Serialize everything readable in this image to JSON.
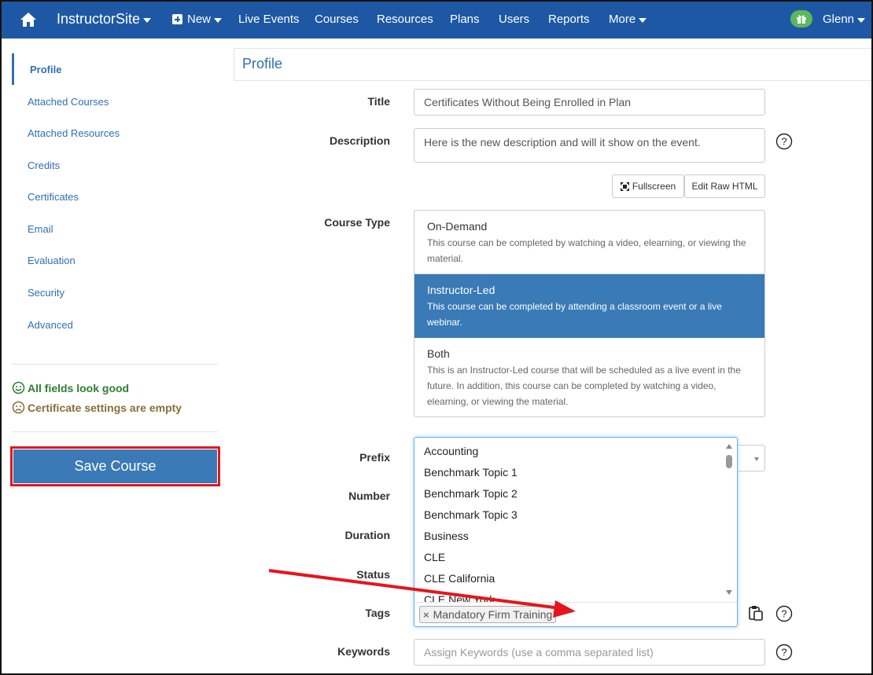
{
  "nav": {
    "brand": "InstructorSite",
    "new_label": "New",
    "items": [
      "Live Events",
      "Courses",
      "Resources",
      "Plans",
      "Users",
      "Reports",
      "More"
    ],
    "user": "Glenn",
    "home_icon": "home-icon",
    "gift_icon": "gift-icon"
  },
  "sidebar": {
    "items": [
      "Profile",
      "Attached Courses",
      "Attached Resources",
      "Credits",
      "Certificates",
      "Email",
      "Evaluation",
      "Security",
      "Advanced"
    ],
    "active": "Profile",
    "status_ok": "All fields look good",
    "status_warn": "Certificate settings are empty",
    "save_label": "Save Course",
    "colors": {
      "ok": "#2e7d32",
      "warn": "#8a6d3b",
      "accent": "#e4161c"
    }
  },
  "main": {
    "title": "Profile",
    "labels": {
      "title": "Title",
      "description": "Description",
      "course_type": "Course Type",
      "prefix": "Prefix",
      "number": "Number",
      "duration": "Duration",
      "status": "Status",
      "tags": "Tags",
      "keywords": "Keywords"
    },
    "title_value": "Certificates Without Being Enrolled in Plan",
    "description_value": "Here is the new description and will it show on the event.",
    "fullscreen_label": "Fullscreen",
    "edit_raw_label": "Edit Raw HTML",
    "course_types": [
      {
        "name": "On-Demand",
        "desc": "This course can be completed by watching a video, elearning, or viewing the material."
      },
      {
        "name": "Instructor-Led",
        "desc": "This course can be completed by attending a classroom event or a live webinar."
      },
      {
        "name": "Both",
        "desc": "This is an Instructor-Led course that will be scheduled as a live event in the future. In addition, this course can be completed by watching a video, elearning, or viewing the material."
      }
    ],
    "selected_course_type": "Instructor-Led",
    "prefix_options": [
      "Accounting",
      "Benchmark Topic 1",
      "Benchmark Topic 2",
      "Benchmark Topic 3",
      "Business",
      "CLE",
      "CLE California",
      "CLE New York"
    ],
    "tags": [
      "Mandatory Firm Training"
    ],
    "keywords_placeholder": "Assign Keywords (use a comma separated list)",
    "colors": {
      "selected": "#3a7ab6",
      "nav": "#1e58a5"
    }
  }
}
